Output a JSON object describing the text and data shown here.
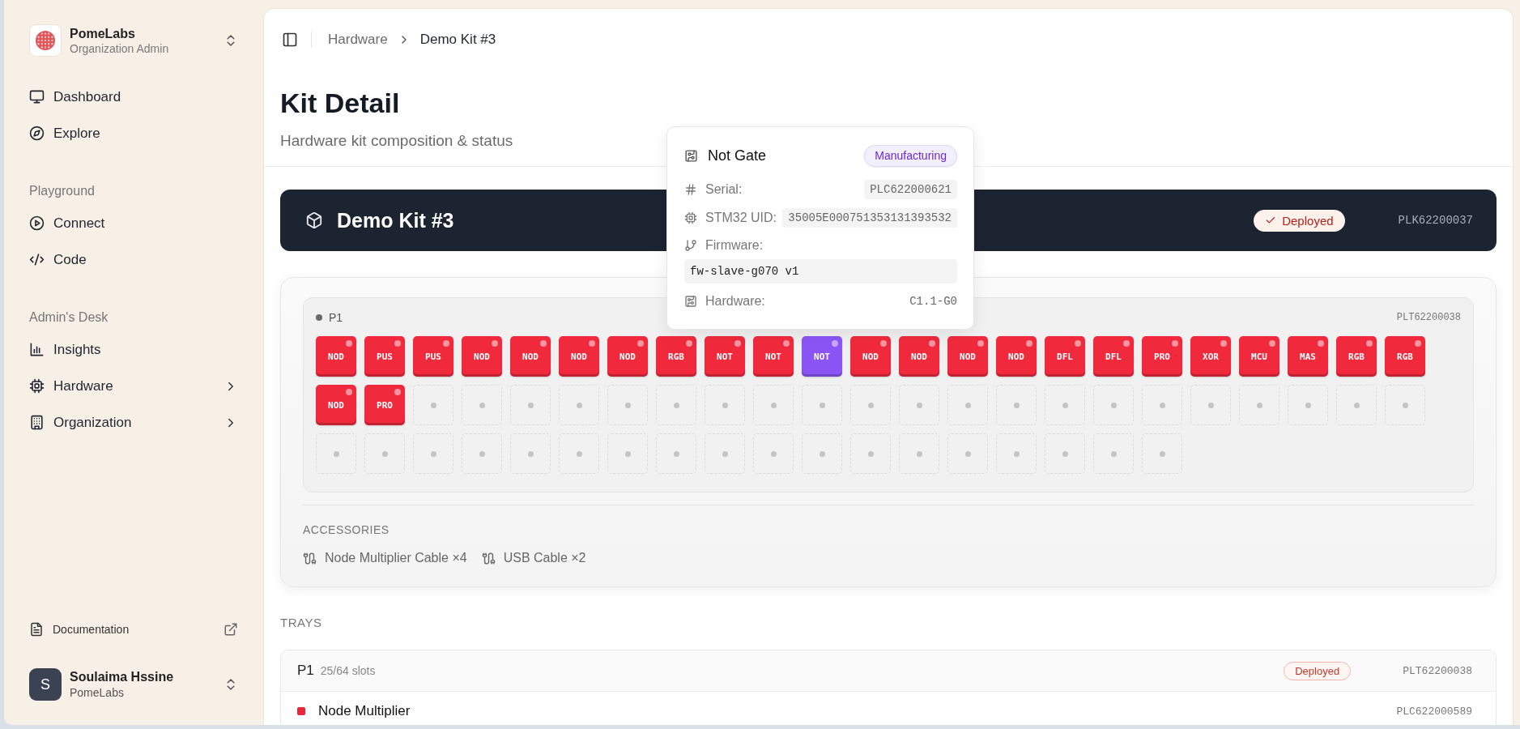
{
  "sidebar": {
    "org": {
      "name": "PomeLabs",
      "role": "Organization Admin"
    },
    "sections": [
      {
        "items": [
          {
            "label": "Dashboard",
            "kind": "link"
          },
          {
            "label": "Explore",
            "kind": "link"
          }
        ]
      },
      {
        "title": "Playground",
        "items": [
          {
            "label": "Connect",
            "kind": "link"
          },
          {
            "label": "Code",
            "kind": "link"
          }
        ]
      },
      {
        "title": "Admin's Desk",
        "items": [
          {
            "label": "Insights",
            "kind": "link"
          },
          {
            "label": "Hardware",
            "kind": "group",
            "expanded": false
          },
          {
            "label": "Organization",
            "kind": "group",
            "expanded": false
          }
        ]
      }
    ],
    "documentation": {
      "label": "Documentation"
    },
    "user": {
      "initial": "S",
      "name": "Soulaima Hssine",
      "org": "PomeLabs"
    }
  },
  "breadcrumb": [
    {
      "label": "Hardware",
      "current": false
    },
    {
      "label": "Demo Kit #3",
      "current": true
    }
  ],
  "page_header": {
    "title": "Kit Detail",
    "subtitle": "Hardware kit composition & status"
  },
  "kit": {
    "name": "Demo Kit #3",
    "status": "Deployed",
    "serial": "PLK62200037"
  },
  "composition": {
    "tray": {
      "label": "P1",
      "serial": "PLT62200038",
      "slots": [
        {
          "kind": "module",
          "code": "NOD",
          "color": "#f02a3c"
        },
        {
          "kind": "module",
          "code": "PUS",
          "color": "#f02a3c"
        },
        {
          "kind": "module",
          "code": "PUS",
          "color": "#f02a3c"
        },
        {
          "kind": "module",
          "code": "NOD",
          "color": "#f02a3c"
        },
        {
          "kind": "module",
          "code": "NOD",
          "color": "#f02a3c"
        },
        {
          "kind": "module",
          "code": "NOD",
          "color": "#f02a3c"
        },
        {
          "kind": "module",
          "code": "NOD",
          "color": "#f02a3c"
        },
        {
          "kind": "module",
          "code": "RGB",
          "color": "#f02a3c"
        },
        {
          "kind": "module",
          "code": "NOT",
          "color": "#f02a3c"
        },
        {
          "kind": "module",
          "code": "NOT",
          "color": "#f02a3c"
        },
        {
          "kind": "module",
          "code": "NOT",
          "color": "#8b55f5"
        },
        {
          "kind": "module",
          "code": "NOD",
          "color": "#f02a3c"
        },
        {
          "kind": "module",
          "code": "NOD",
          "color": "#f02a3c"
        },
        {
          "kind": "module",
          "code": "NOD",
          "color": "#f02a3c"
        },
        {
          "kind": "module",
          "code": "NOD",
          "color": "#f02a3c"
        },
        {
          "kind": "module",
          "code": "DFL",
          "color": "#f02a3c"
        },
        {
          "kind": "module",
          "code": "DFL",
          "color": "#f02a3c"
        },
        {
          "kind": "module",
          "code": "PRO",
          "color": "#f02a3c"
        },
        {
          "kind": "module",
          "code": "XOR",
          "color": "#f02a3c"
        },
        {
          "kind": "module",
          "code": "MCU",
          "color": "#f02a3c"
        },
        {
          "kind": "module",
          "code": "MAS",
          "color": "#f02a3c"
        },
        {
          "kind": "module",
          "code": "RGB",
          "color": "#f02a3c"
        },
        {
          "kind": "module",
          "code": "RGB",
          "color": "#f02a3c"
        },
        {
          "kind": "module",
          "code": "NOD",
          "color": "#f02a3c"
        },
        {
          "kind": "module",
          "code": "PRO",
          "color": "#f02a3c"
        },
        {
          "kind": "empty"
        },
        {
          "kind": "empty"
        },
        {
          "kind": "empty"
        },
        {
          "kind": "empty"
        },
        {
          "kind": "empty"
        },
        {
          "kind": "empty"
        },
        {
          "kind": "empty"
        },
        {
          "kind": "empty"
        },
        {
          "kind": "empty"
        },
        {
          "kind": "empty"
        },
        {
          "kind": "empty"
        },
        {
          "kind": "empty"
        },
        {
          "kind": "empty"
        },
        {
          "kind": "empty"
        },
        {
          "kind": "empty"
        },
        {
          "kind": "empty"
        },
        {
          "kind": "empty"
        },
        {
          "kind": "empty"
        },
        {
          "kind": "empty"
        },
        {
          "kind": "empty"
        },
        {
          "kind": "empty"
        },
        {
          "kind": "empty"
        },
        {
          "kind": "empty"
        },
        {
          "kind": "empty"
        },
        {
          "kind": "empty"
        },
        {
          "kind": "empty"
        },
        {
          "kind": "empty"
        },
        {
          "kind": "empty"
        },
        {
          "kind": "empty"
        },
        {
          "kind": "empty"
        },
        {
          "kind": "empty"
        },
        {
          "kind": "empty"
        },
        {
          "kind": "empty"
        },
        {
          "kind": "empty"
        },
        {
          "kind": "empty"
        },
        {
          "kind": "empty"
        },
        {
          "kind": "empty"
        },
        {
          "kind": "empty"
        },
        {
          "kind": "empty"
        }
      ]
    },
    "accessories": {
      "title": "ACCESSORIES",
      "items": [
        {
          "label": "Node Multiplier Cable ×4"
        },
        {
          "label": "USB Cable ×2"
        }
      ]
    }
  },
  "trays": {
    "title": "TRAYS",
    "items": [
      {
        "name": "P1",
        "slots": "25/64 slots",
        "status": "Deployed",
        "serial": "PLT62200038",
        "modules": [
          {
            "name": "Node Multiplier",
            "serial": "PLC622000589",
            "color": "#e8283a"
          }
        ]
      }
    ]
  },
  "tooltip": {
    "title": "Not Gate",
    "status": "Manufacturing",
    "fields": [
      {
        "kind": "inline",
        "label": "Serial:",
        "value": "PLC622000621"
      },
      {
        "kind": "inline",
        "label": "STM32 UID:",
        "value": "35005E000751353131393532"
      },
      {
        "kind": "block",
        "label": "Firmware:",
        "value": "fw-slave-g070 v1"
      },
      {
        "kind": "plain",
        "label": "Hardware:",
        "value": "C1.1-G0"
      }
    ]
  }
}
